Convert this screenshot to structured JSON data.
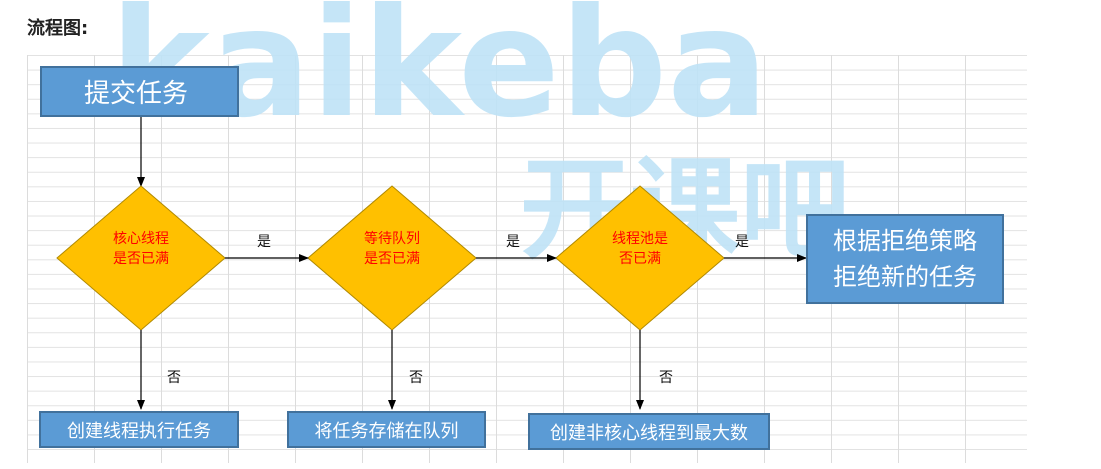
{
  "heading": "流程图:",
  "watermark": {
    "brand": "kaikeba",
    "brand_cn": "开课吧"
  },
  "nodes": {
    "submit": "提交任务",
    "core_full": [
      "核心线程",
      "是否已满"
    ],
    "queue_full": [
      "等待队列",
      "是否已满"
    ],
    "pool_full": [
      "线程池是",
      "否已满"
    ],
    "reject": [
      "根据拒绝策略",
      "拒绝新的任务"
    ],
    "create_core": "创建线程执行任务",
    "store_queue": "将任务存储在队列",
    "create_noncore": "创建非核心线程到最大数"
  },
  "edge_labels": {
    "yes": "是",
    "no": "否"
  },
  "colors": {
    "box": "#5b9bd5",
    "diamond": "#ffc000",
    "diamond_text": "#ff0000",
    "watermark": "#bfe3f7"
  }
}
